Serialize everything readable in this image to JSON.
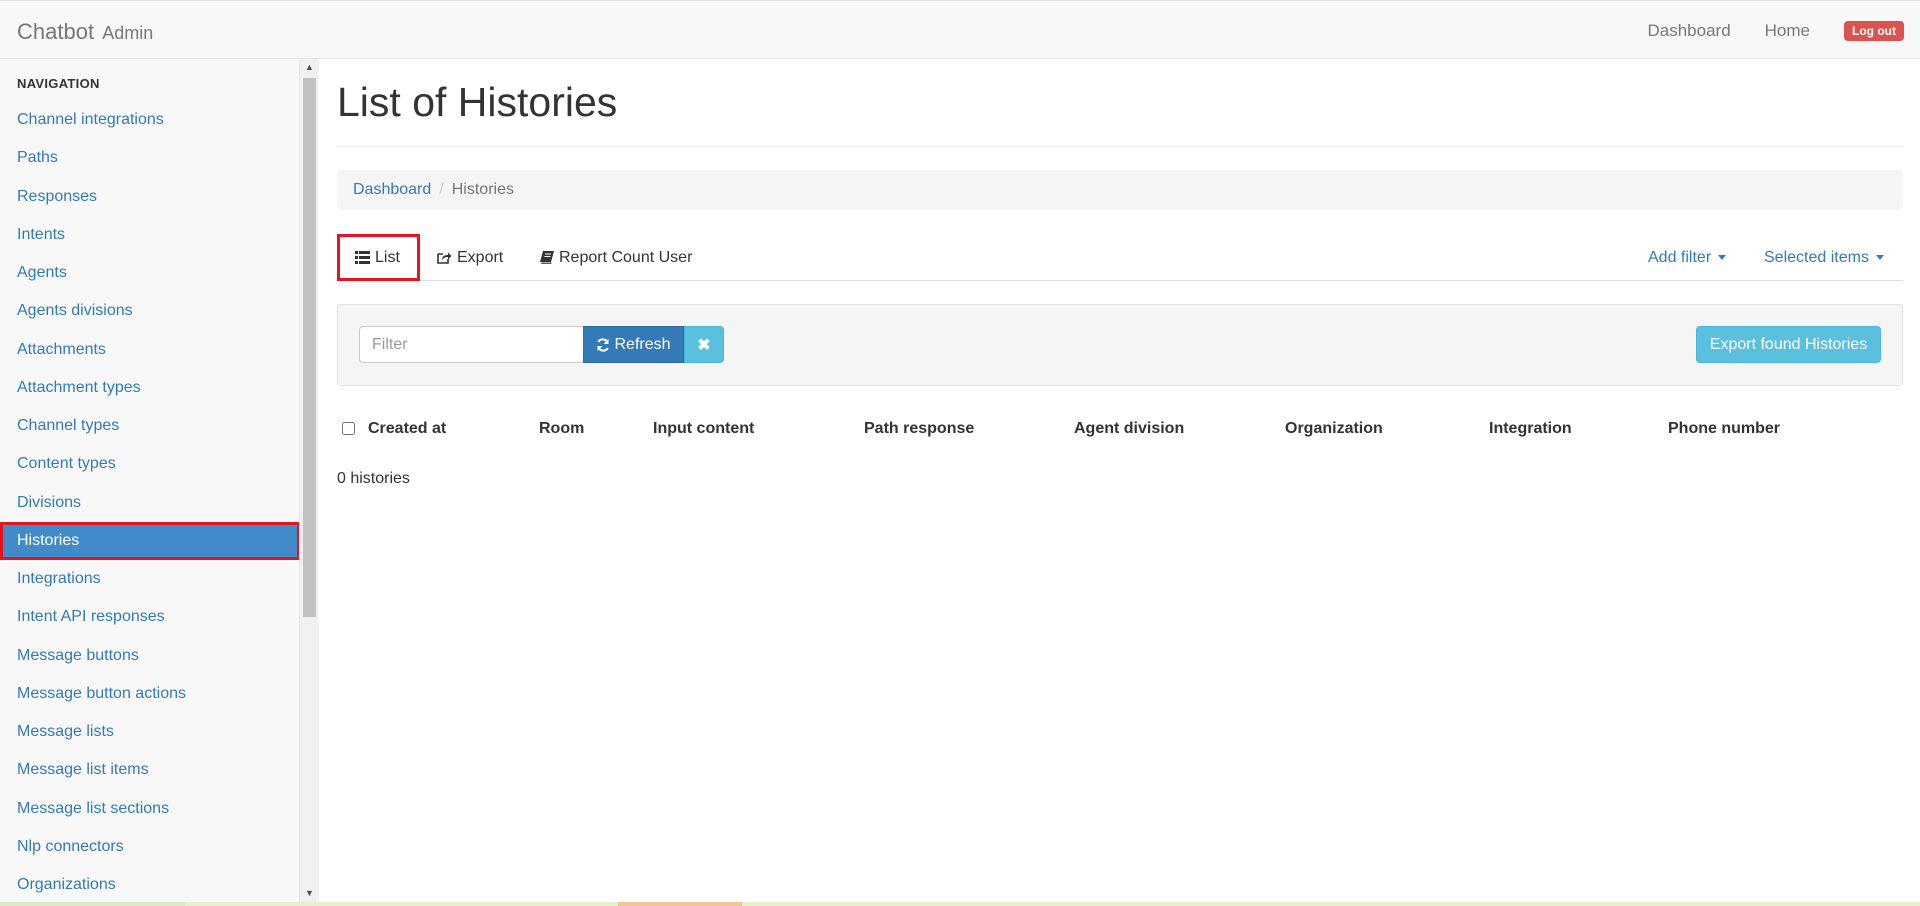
{
  "navbar": {
    "brand": "Chatbot",
    "brand_sub": "Admin",
    "links": [
      "Dashboard",
      "Home"
    ],
    "logout": "Log out"
  },
  "sidebar": {
    "header": "NAVIGATION",
    "items": [
      {
        "label": "Channel integrations"
      },
      {
        "label": "Paths"
      },
      {
        "label": "Responses"
      },
      {
        "label": "Intents"
      },
      {
        "label": "Agents"
      },
      {
        "label": "Agents divisions"
      },
      {
        "label": "Attachments"
      },
      {
        "label": "Attachment types"
      },
      {
        "label": "Channel types"
      },
      {
        "label": "Content types"
      },
      {
        "label": "Divisions"
      },
      {
        "label": "Histories",
        "active": true
      },
      {
        "label": "Integrations"
      },
      {
        "label": "Intent API responses"
      },
      {
        "label": "Message buttons"
      },
      {
        "label": "Message button actions"
      },
      {
        "label": "Message lists"
      },
      {
        "label": "Message list items"
      },
      {
        "label": "Message list sections"
      },
      {
        "label": "Nlp connectors"
      },
      {
        "label": "Organizations"
      }
    ]
  },
  "main": {
    "title": "List of Histories",
    "breadcrumb": {
      "link": "Dashboard",
      "separator": "/",
      "current": "Histories"
    },
    "tabs": {
      "list": "List",
      "export": "Export",
      "report": "Report Count User",
      "add_filter": "Add filter",
      "selected_items": "Selected items"
    },
    "filter": {
      "placeholder": "Filter",
      "refresh": "Refresh",
      "export_found": "Export found Histories"
    },
    "table": {
      "columns": [
        "Created at",
        "Room",
        "Input content",
        "Path response",
        "Agent division",
        "Organization",
        "Integration",
        "Phone number"
      ]
    },
    "count": "0 histories"
  },
  "icons": {
    "list": "list-icon",
    "export": "share-icon",
    "report": "book-icon",
    "refresh": "refresh-icon",
    "clear": "close-icon",
    "caret": "caret-down-icon"
  },
  "colors": {
    "link": "#337ab7",
    "active_bg": "#428bca",
    "highlight_border": "#e3151e",
    "info": "#5bc0de",
    "danger": "#d9534f"
  }
}
